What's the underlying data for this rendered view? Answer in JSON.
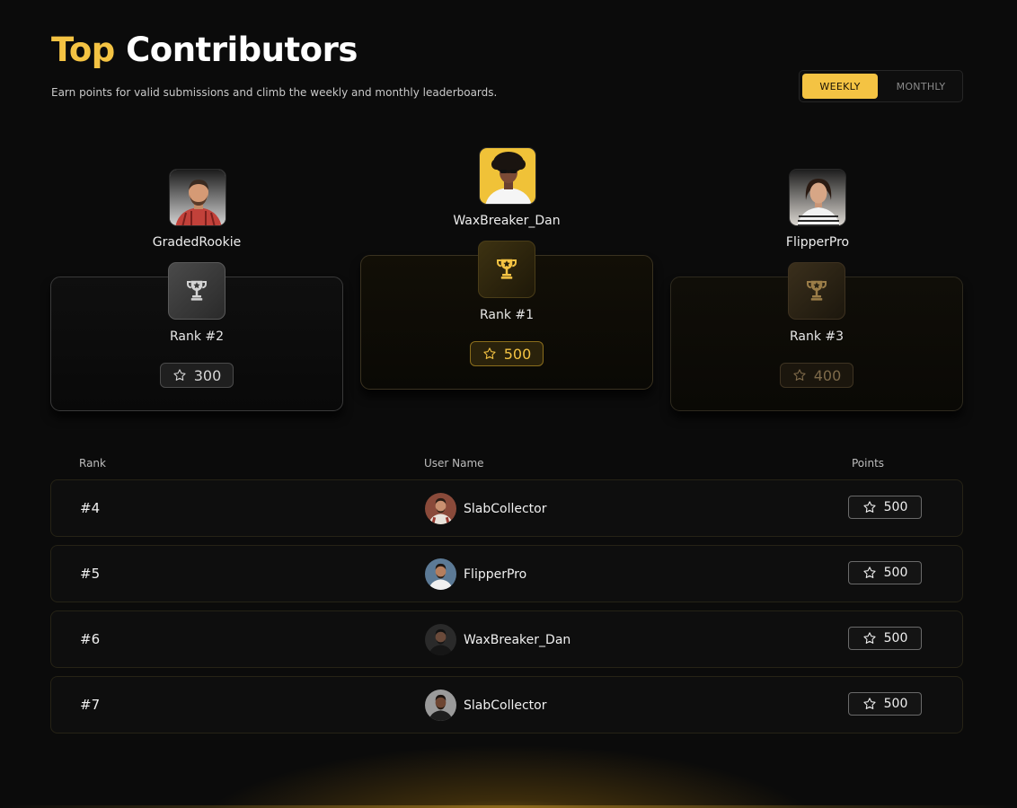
{
  "header": {
    "title_accent": "Top",
    "title_rest": "Contributors",
    "subtitle": "Earn points for valid submissions and climb the weekly and monthly leaderboards."
  },
  "period_toggle": {
    "options": [
      "WEEKLY",
      "MONTHLY"
    ],
    "selected": "WEEKLY"
  },
  "podium": {
    "first": {
      "name": "WaxBreaker_Dan",
      "rank_label": "Rank #1",
      "points": "500"
    },
    "second": {
      "name": "GradedRookie",
      "rank_label": "Rank #2",
      "points": "300"
    },
    "third": {
      "name": "FlipperPro",
      "rank_label": "Rank #3",
      "points": "400"
    }
  },
  "table": {
    "headers": {
      "rank": "Rank",
      "user": "User Name",
      "points": "Points"
    },
    "rows": [
      {
        "rank": "#4",
        "user": "SlabCollector",
        "points": "500"
      },
      {
        "rank": "#5",
        "user": "FlipperPro",
        "points": "500"
      },
      {
        "rank": "#6",
        "user": "WaxBreaker_Dan",
        "points": "500"
      },
      {
        "rank": "#7",
        "user": "SlabCollector",
        "points": "500"
      }
    ]
  },
  "colors": {
    "accent": "#f4c343",
    "background": "#0b0b0b"
  },
  "icons": {
    "trophy": "trophy-icon",
    "star": "star-icon"
  }
}
